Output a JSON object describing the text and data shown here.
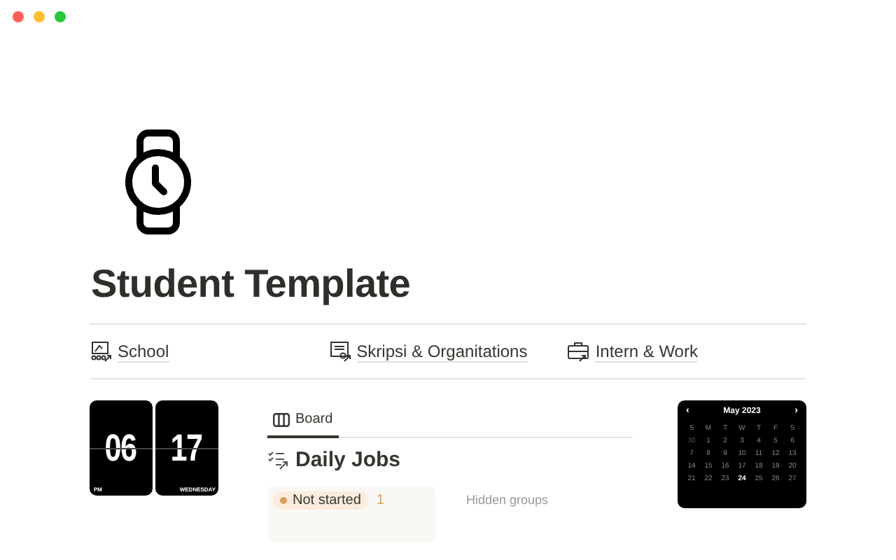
{
  "title": "Student Template",
  "links": [
    {
      "label": "School"
    },
    {
      "label": "Skripsi & Organitations"
    },
    {
      "label": "Intern & Work"
    }
  ],
  "clock": {
    "hour": "06",
    "minute": "17",
    "period": "PM",
    "weekday": "WEDNESDAY"
  },
  "board": {
    "tabs": [
      {
        "label": "Board",
        "selected": true
      }
    ],
    "heading": "Daily Jobs",
    "groups": [
      {
        "label": "Not started",
        "count": "1",
        "color": "#d9a05b"
      }
    ],
    "hidden_label": "Hidden groups"
  },
  "calendar": {
    "month": "May 2023",
    "prev": "‹",
    "next": "›",
    "weekdays": [
      "S",
      "M",
      "T",
      "W",
      "T",
      "F",
      "S"
    ],
    "days": [
      {
        "d": "30",
        "muted": true,
        "today": false
      },
      {
        "d": "1",
        "muted": false,
        "today": false
      },
      {
        "d": "2",
        "muted": false,
        "today": false
      },
      {
        "d": "3",
        "muted": false,
        "today": false
      },
      {
        "d": "4",
        "muted": false,
        "today": false
      },
      {
        "d": "5",
        "muted": false,
        "today": false
      },
      {
        "d": "6",
        "muted": false,
        "today": false
      },
      {
        "d": "7",
        "muted": false,
        "today": false
      },
      {
        "d": "8",
        "muted": false,
        "today": false
      },
      {
        "d": "9",
        "muted": false,
        "today": false
      },
      {
        "d": "10",
        "muted": false,
        "today": false
      },
      {
        "d": "11",
        "muted": false,
        "today": false
      },
      {
        "d": "12",
        "muted": false,
        "today": false
      },
      {
        "d": "13",
        "muted": false,
        "today": false
      },
      {
        "d": "14",
        "muted": false,
        "today": false
      },
      {
        "d": "15",
        "muted": false,
        "today": false
      },
      {
        "d": "16",
        "muted": false,
        "today": false
      },
      {
        "d": "17",
        "muted": false,
        "today": false
      },
      {
        "d": "18",
        "muted": false,
        "today": false
      },
      {
        "d": "19",
        "muted": false,
        "today": false
      },
      {
        "d": "20",
        "muted": false,
        "today": false
      },
      {
        "d": "21",
        "muted": false,
        "today": false
      },
      {
        "d": "22",
        "muted": false,
        "today": false
      },
      {
        "d": "23",
        "muted": false,
        "today": false
      },
      {
        "d": "24",
        "muted": false,
        "today": true
      },
      {
        "d": "25",
        "muted": false,
        "today": false
      },
      {
        "d": "26",
        "muted": false,
        "today": false
      },
      {
        "d": "27",
        "muted": false,
        "today": false
      }
    ]
  }
}
